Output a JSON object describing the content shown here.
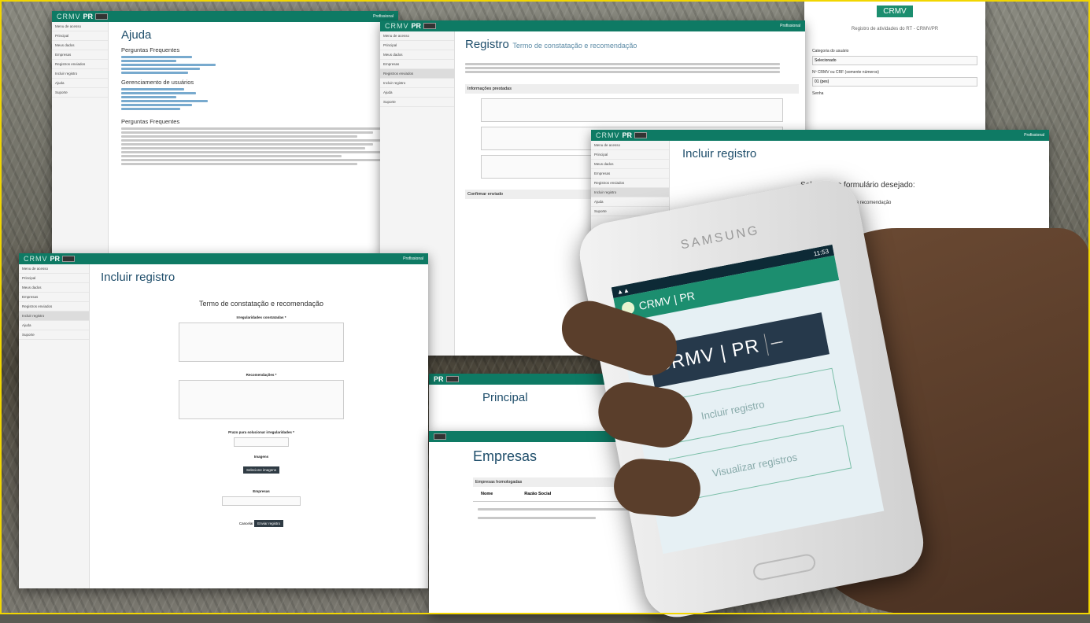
{
  "brand": {
    "crmv": "CRMV",
    "pr": "PR",
    "tagline": "Registro de atividades do RT - CRMV/PR"
  },
  "user": "Profissional",
  "sidebar": [
    "Menu de acesso",
    "Principal",
    "Meus dados",
    "Empresas",
    "Registros enviados",
    "Incluir registro",
    "Ajuda",
    "Suporte"
  ],
  "help": {
    "title": "Ajuda",
    "faq": "Perguntas Frequentes",
    "manage": "Gerenciamento de usuários"
  },
  "registro": {
    "title": "Registro",
    "subtitle": "Termo de constatação e recomendação",
    "info": "Informações prestadas",
    "photos": "Confirmar enviado"
  },
  "incluir_top": {
    "title": "Incluir registro",
    "prompt": "Selecione o formulário desejado:",
    "option": "Termo de constatação e recomendação"
  },
  "incluir_form": {
    "title": "Incluir registro",
    "form_title": "Termo de constatação e recomendação",
    "f1": "Irregularidades constatadas *",
    "f2": "Recomendações *",
    "f3": "Prazo para solucionar irregularidades *",
    "f4": "Imagens",
    "f4btn": "Selecione imagens",
    "f5": "Empresas",
    "cancel": "Cancelar",
    "submit": "Enviar registro"
  },
  "principal": {
    "title": "Principal"
  },
  "empresas": {
    "title": "Empresas",
    "table_title": "Empresas homologadas",
    "cols": [
      "Nome",
      "Razão Social"
    ]
  },
  "filter": {
    "label": "Categoria do usuário",
    "value": "Selecionado",
    "crmv_label": "Nº CRMV ou CRF (somente números)",
    "crmv_value": "01 (pes)",
    "senha": "Senha"
  },
  "phone": {
    "brand": "SAMSUNG",
    "time": "11:53",
    "app": "CRMV | PR",
    "btn1": "Incluir registro",
    "btn2": "Visualizar registros"
  }
}
